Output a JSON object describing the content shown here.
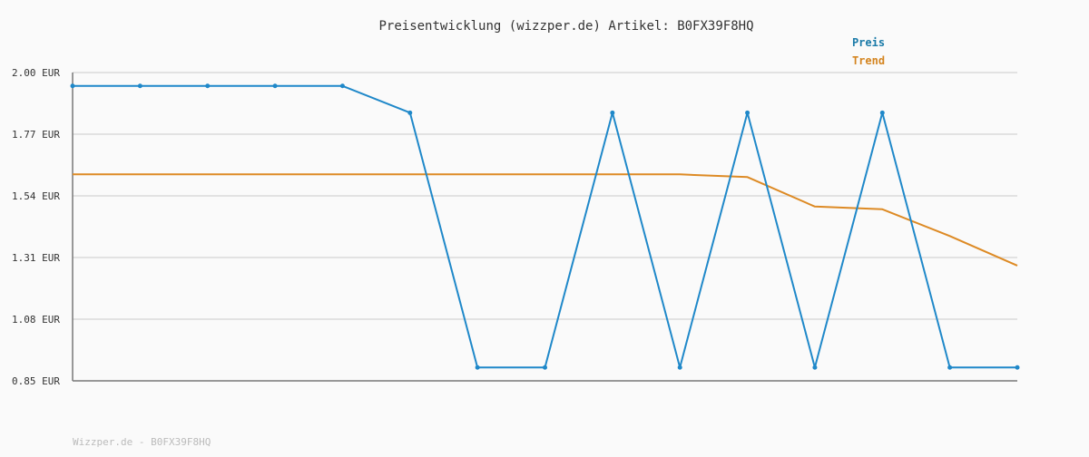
{
  "chart_data": {
    "type": "line",
    "title": "Preisentwicklung (wizzper.de) Artikel: B0FX39F8HQ",
    "xlabel": "",
    "ylabel": "",
    "ylim": [
      0.85,
      2.0
    ],
    "y_ticks": [
      "2.00 EUR",
      "1.77 EUR",
      "1.54 EUR",
      "1.31 EUR",
      "1.08 EUR",
      "0.85 EUR"
    ],
    "y_tick_values": [
      2.0,
      1.77,
      1.54,
      1.31,
      1.08,
      0.85
    ],
    "x": [
      0,
      1,
      2,
      3,
      4,
      5,
      6,
      7,
      8,
      9,
      10,
      11,
      12,
      13,
      14
    ],
    "grid": true,
    "legend_placement": "top-right",
    "series": [
      {
        "name": "Preis",
        "color": "#1f88c9",
        "markers": true,
        "values": [
          1.95,
          1.95,
          1.95,
          1.95,
          1.95,
          1.85,
          0.9,
          0.9,
          1.85,
          0.9,
          1.85,
          0.9,
          1.85,
          0.9,
          0.9
        ]
      },
      {
        "name": "Trend",
        "color": "#dd8a24",
        "markers": false,
        "values": [
          1.62,
          1.62,
          1.62,
          1.62,
          1.62,
          1.62,
          1.62,
          1.62,
          1.62,
          1.62,
          1.61,
          1.5,
          1.49,
          1.39,
          1.28
        ]
      }
    ]
  },
  "footer": {
    "text": "Wizzper.de - B0FX39F8HQ"
  },
  "colors": {
    "background": "#fafafa",
    "grid": "#e2e2e2",
    "axis": "#777777",
    "text": "#333333",
    "legend_preis": "#1a7aa8",
    "legend_trend": "#d4841f",
    "footer": "#bbbbbb"
  }
}
